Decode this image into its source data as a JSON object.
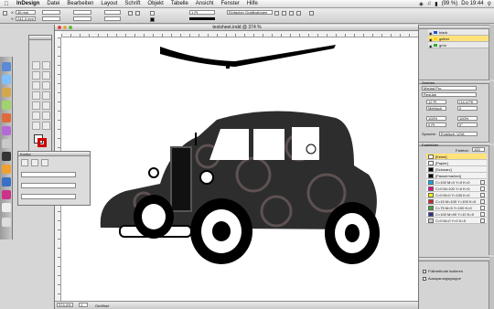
{
  "menubar": {
    "app": "InDesign",
    "items": [
      "Datei",
      "Bearbeiten",
      "Layout",
      "Schrift",
      "Objekt",
      "Tabelle",
      "Ansicht",
      "Fenster",
      "Hilfe"
    ],
    "battery": "(99 %)",
    "clock": "Do 19:44"
  },
  "control": {
    "x": "36 mm",
    "y": "241,3 mm",
    "stroke_weight": "1 Pt",
    "style": "Einfacher Grafikrahmen"
  },
  "document": {
    "title": "testsheet.indd @ 374 %",
    "zoom": "374,4%",
    "page": "1",
    "status": "Geöffnet"
  },
  "layers": {
    "items": [
      {
        "name": "black",
        "color": "#2255cc"
      },
      {
        "name": "gelber",
        "color": "#ffd400"
      },
      {
        "name": "grün",
        "color": "#33aa33"
      }
    ]
  },
  "character": {
    "header": "Zeichen",
    "font": "Myriad Pro",
    "style": "Regular",
    "size": "12 Pt",
    "leading": "(14,4 Pt)",
    "kerning": "Metrisch",
    "tracking": "0",
    "scale_v": "100%",
    "scale_h": "100%",
    "baseline": "0 Pt",
    "skew": "0°",
    "language_label": "Sprache:",
    "language": "Englisch: USA"
  },
  "swatches": {
    "header": "Farbfelder",
    "tint_label": "Farbton:",
    "tint": "100",
    "items": [
      {
        "name": "[Keine]",
        "color": "#ffffff"
      },
      {
        "name": "[Papier]",
        "color": "#ffffff"
      },
      {
        "name": "[Schwarz]",
        "color": "#000000"
      },
      {
        "name": "[Passermarken]",
        "color": "#000000"
      },
      {
        "name": "C=100 M=0 Y=0 K=0",
        "color": "#00aeef"
      },
      {
        "name": "C=0 M=100 Y=0 K=0",
        "color": "#ec008c"
      },
      {
        "name": "C=0 M=0 Y=100 K=0",
        "color": "#fff200"
      },
      {
        "name": "C=15 M=100 Y=100 K=0",
        "color": "#d2232a"
      },
      {
        "name": "C=75 M=5 Y=100 K=0",
        "color": "#3aa935"
      },
      {
        "name": "C=100 M=90 Y=10 K=0",
        "color": "#2e3192"
      },
      {
        "name": "C=0 M=0 Y=0 K=0",
        "color": "#cccccc"
      }
    ]
  },
  "align": {
    "items": [
      "Füllmethode isolieren",
      "Aussparungsgruppe"
    ]
  },
  "floatpanel": {
    "title": "Kontur"
  }
}
